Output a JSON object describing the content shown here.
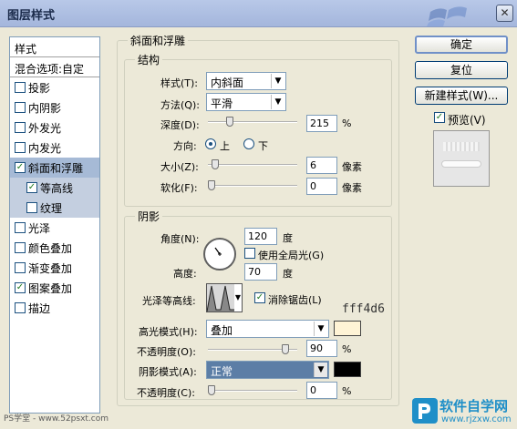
{
  "window": {
    "title": "图层样式"
  },
  "styles_list": {
    "header": "样式",
    "blend": "混合选项:自定",
    "items": [
      {
        "label": "投影",
        "checked": false
      },
      {
        "label": "内阴影",
        "checked": false
      },
      {
        "label": "外发光",
        "checked": false
      },
      {
        "label": "内发光",
        "checked": false
      },
      {
        "label": "斜面和浮雕",
        "checked": true
      },
      {
        "label": "等高线",
        "checked": true
      },
      {
        "label": "纹理",
        "checked": false
      },
      {
        "label": "光泽",
        "checked": false
      },
      {
        "label": "颜色叠加",
        "checked": false
      },
      {
        "label": "渐变叠加",
        "checked": false
      },
      {
        "label": "图案叠加",
        "checked": true
      },
      {
        "label": "描边",
        "checked": false
      }
    ]
  },
  "bevel": {
    "section_title": "斜面和浮雕",
    "structure_title": "结构",
    "style_label": "样式(T):",
    "style_value": "内斜面",
    "technique_label": "方法(Q):",
    "technique_value": "平滑",
    "depth_label": "深度(D):",
    "depth_value": "215",
    "depth_unit": "%",
    "depth_fraction": 0.22,
    "direction_label": "方向:",
    "direction_up": "上",
    "direction_down": "下",
    "size_label": "大小(Z):",
    "size_value": "6",
    "size_unit": "像素",
    "size_fraction": 0.04,
    "soften_label": "软化(F):",
    "soften_value": "0",
    "soften_unit": "像素",
    "soften_fraction": 0.0
  },
  "shading": {
    "title": "阴影",
    "angle_label": "角度(N):",
    "angle_value": "120",
    "angle_unit": "度",
    "global_light_label": "使用全局光(G)",
    "global_light_checked": false,
    "altitude_label": "高度:",
    "altitude_value": "70",
    "altitude_unit": "度",
    "gloss_label": "光泽等高线:",
    "antialias_label": "消除锯齿(L)",
    "antialias_checked": true,
    "highlight_mode_label": "高光模式(H):",
    "highlight_mode_value": "叠加",
    "highlight_color": "#fff4d6",
    "highlight_opacity_label": "不透明度(O):",
    "highlight_opacity_value": "90",
    "highlight_opacity_unit": "%",
    "highlight_opacity_fraction": 0.9,
    "shadow_mode_label": "阴影模式(A):",
    "shadow_mode_value": "正常",
    "shadow_color": "#000000",
    "shadow_opacity_label": "不透明度(C):",
    "shadow_opacity_value": "0",
    "shadow_opacity_unit": "%",
    "shadow_opacity_fraction": 0.0
  },
  "annotation": {
    "hex": "fff4d6"
  },
  "buttons": {
    "ok": "确定",
    "reset": "复位",
    "new_style": "新建样式(W)...",
    "preview_label": "预览(V)",
    "preview_checked": true
  },
  "watermarks": {
    "left": "PS学堂 - www.52psxt.com",
    "right_brand": "软件自学网",
    "right_url": "www.rjzxw.com"
  }
}
